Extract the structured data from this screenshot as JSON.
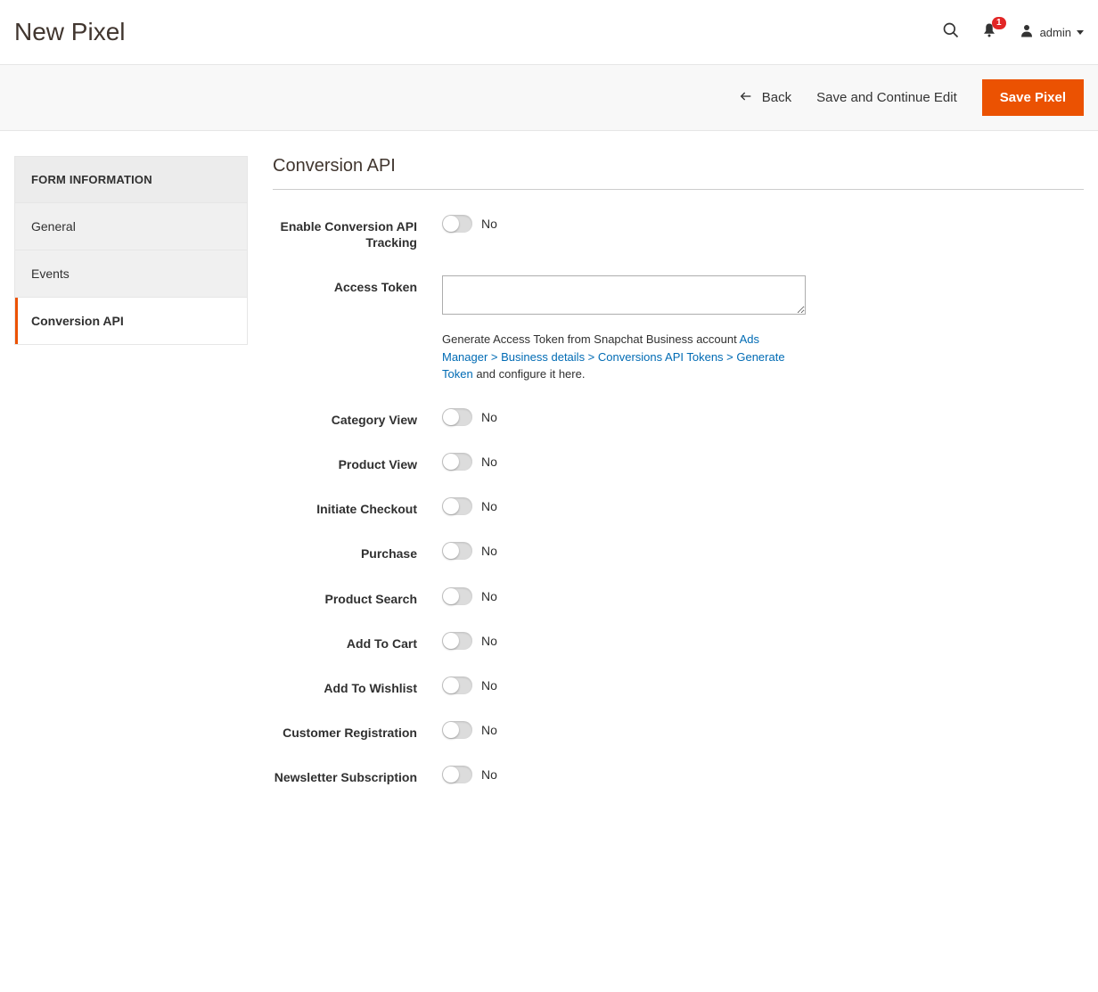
{
  "header": {
    "title": "New Pixel",
    "notif_count": "1",
    "user": "admin"
  },
  "actions": {
    "back": "Back",
    "save_continue": "Save and Continue Edit",
    "save": "Save Pixel"
  },
  "sidebar": {
    "title": "FORM INFORMATION",
    "items": [
      {
        "label": "General",
        "active": false
      },
      {
        "label": "Events",
        "active": false
      },
      {
        "label": "Conversion API",
        "active": true
      }
    ]
  },
  "main": {
    "section_title": "Conversion API",
    "fields": {
      "enable": {
        "label": "Enable Conversion API Tracking",
        "value": "No"
      },
      "access_token": {
        "label": "Access Token",
        "value": "",
        "help_pre": "Generate Access Token from Snapchat Business account ",
        "help_link": "Ads Manager > Business details > Conversions API Tokens > Generate Token",
        "help_post": " and configure it here."
      },
      "toggles": [
        {
          "label": "Category View",
          "value": "No"
        },
        {
          "label": "Product View",
          "value": "No"
        },
        {
          "label": "Initiate Checkout",
          "value": "No"
        },
        {
          "label": "Purchase",
          "value": "No"
        },
        {
          "label": "Product Search",
          "value": "No"
        },
        {
          "label": "Add To Cart",
          "value": "No"
        },
        {
          "label": "Add To Wishlist",
          "value": "No"
        },
        {
          "label": "Customer Registration",
          "value": "No"
        },
        {
          "label": "Newsletter Subscription",
          "value": "No"
        }
      ]
    }
  }
}
